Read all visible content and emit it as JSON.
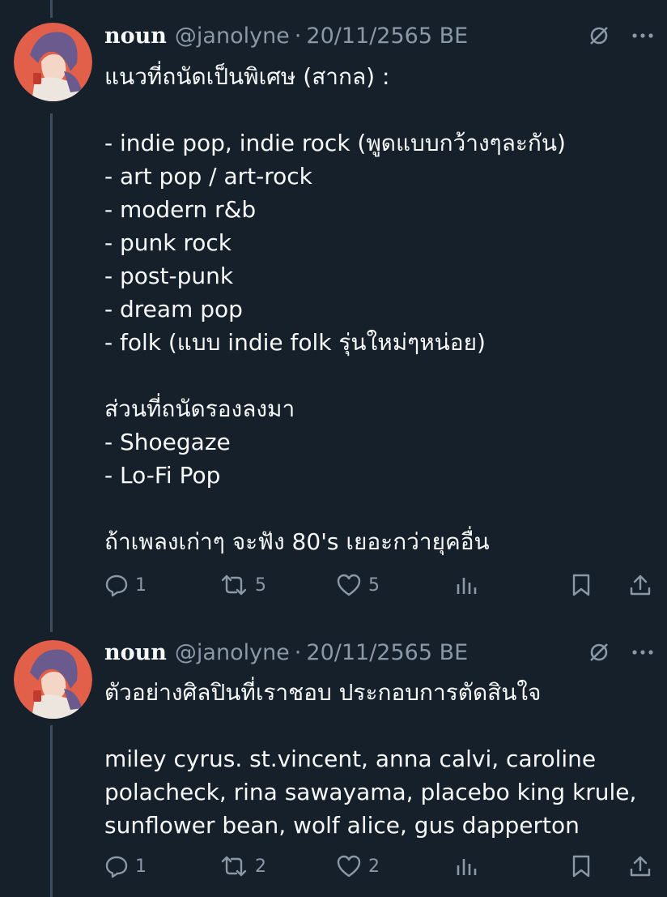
{
  "tweets": [
    {
      "author": {
        "name": "noun",
        "handle": "@janolyne",
        "separator": "·",
        "date": "20/11/2565 BE"
      },
      "text": "แนวที่ถนัดเป็นพิเศษ (สากล) :\n\n- indie pop, indie rock (พูดแบบกว้างๆละกัน)\n- art pop / art-rock\n- modern r&b\n- punk rock\n- post-punk\n- dream pop\n- folk (แบบ indie folk รุ่นใหม่ๆหน่อย)\n\nส่วนที่ถนัดรองลงมา\n- Shoegaze\n- Lo-Fi Pop\n\nถ้าเพลงเก่าๆ จะฟัง 80's เยอะกว่ายุคอื่น",
      "stats": {
        "replies": "1",
        "retweets": "5",
        "likes": "5"
      }
    },
    {
      "author": {
        "name": "noun",
        "handle": "@janolyne",
        "separator": "·",
        "date": "20/11/2565 BE"
      },
      "text": "ตัวอย่างศิลปินที่เราชอบ ประกอบการตัดสินใจ\n\nmiley cyrus. st.vincent, anna calvi, caroline polacheck, rina sawayama, placebo king krule, sunflower bean, wolf alice, gus dapperton",
      "stats": {
        "replies": "1",
        "retweets": "2",
        "likes": "2"
      }
    }
  ],
  "icons": {
    "header": [
      "grok-slash-icon",
      "more-icon"
    ],
    "actions": [
      "reply-icon",
      "retweet-icon",
      "like-icon",
      "views-icon",
      "bookmark-icon",
      "share-icon"
    ]
  },
  "colors": {
    "background": "#15202b",
    "text": "#f7f9f9",
    "secondary": "#8b98a5",
    "thread_line": "#3d4d5c"
  }
}
